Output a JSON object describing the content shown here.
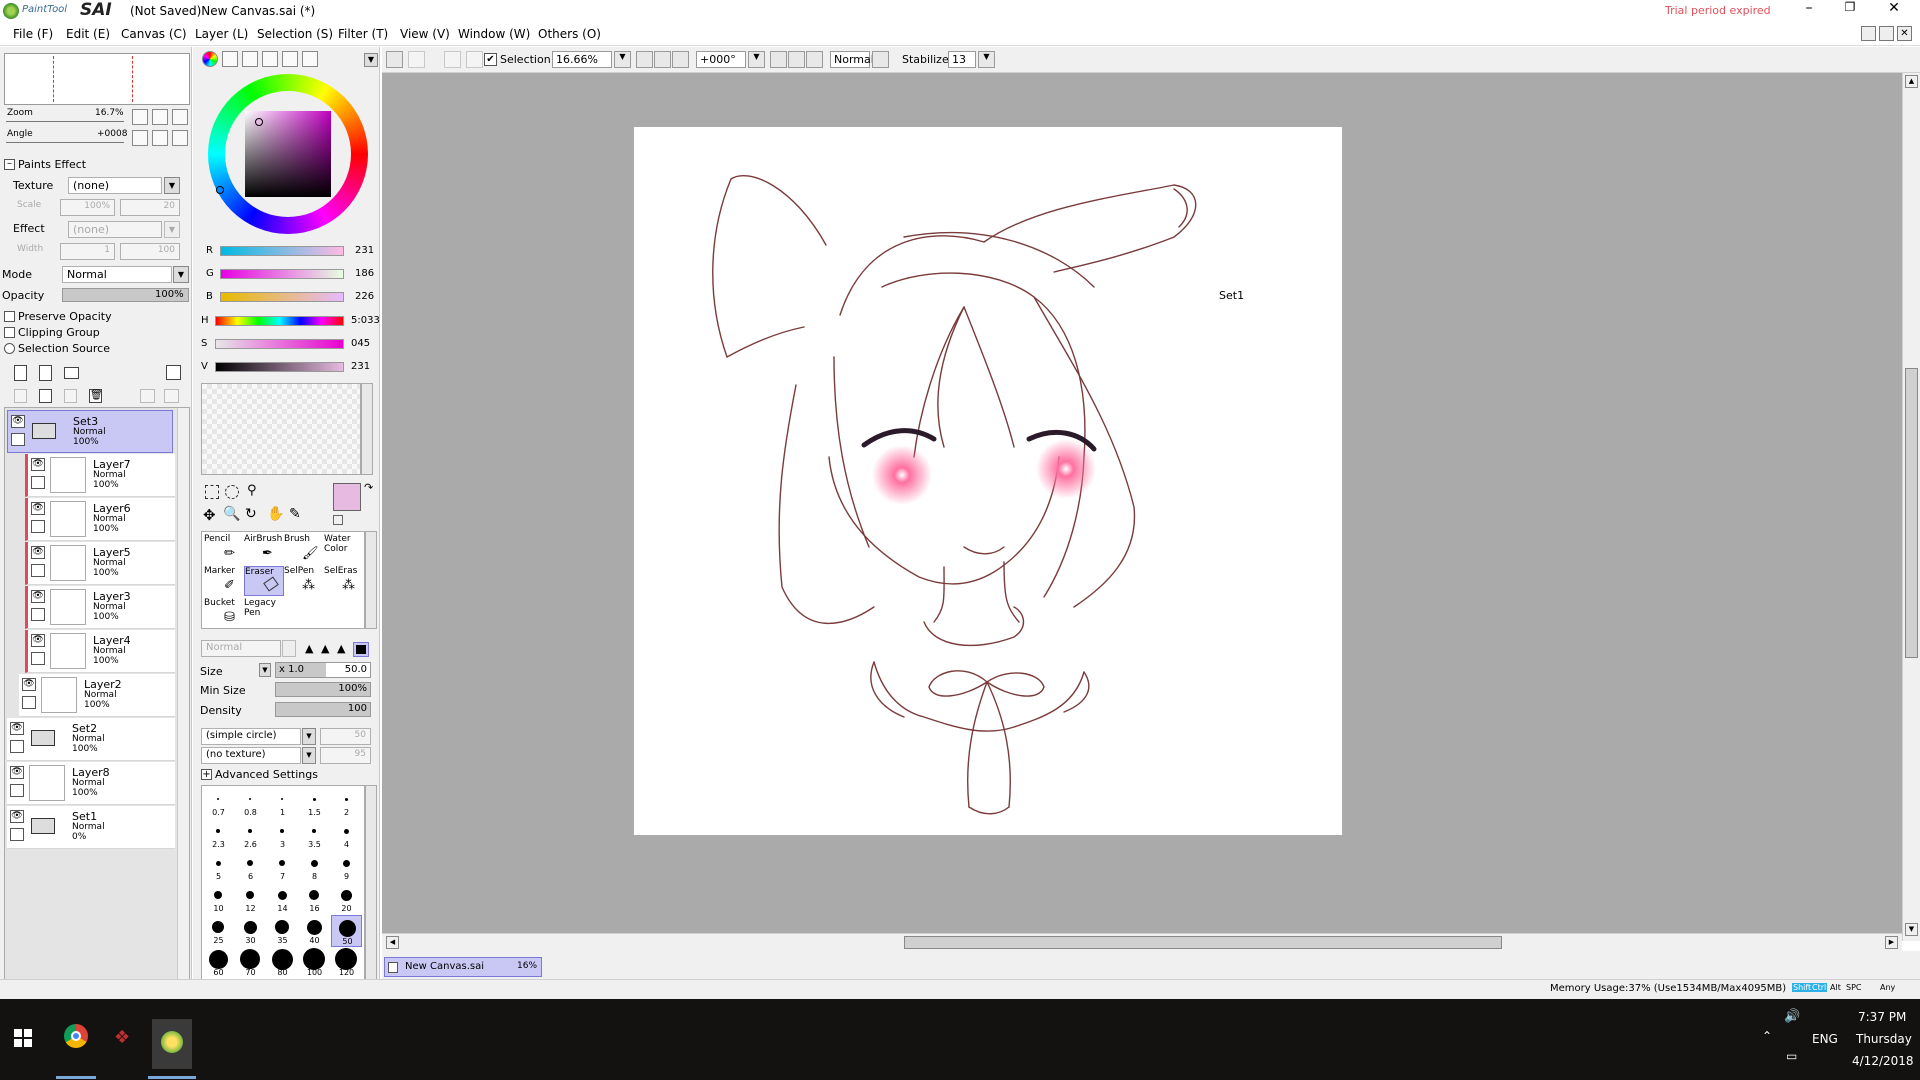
{
  "window": {
    "app_name": "SAI",
    "app_prefix": "PaintTool",
    "title": "(Not Saved)New Canvas.sai (*)",
    "trial": "Trial period expired",
    "accent_trial": "#e0505a"
  },
  "menu": [
    "File (F)",
    "Edit (E)",
    "Canvas (C)",
    "Layer (L)",
    "Selection (S)",
    "Filter (T)",
    "View (V)",
    "Window (W)",
    "Others (O)"
  ],
  "toolbar": {
    "selection_label": "Selection",
    "zoom_value": "16.66%",
    "angle_value": "+000°",
    "blend_mode": "Normal",
    "stabilizer_label": "Stabilizer",
    "stabilizer_value": "13"
  },
  "navigator": {
    "zoom_label": "Zoom",
    "zoom_value": "16.7%",
    "angle_label": "Angle",
    "angle_value": "+0008"
  },
  "paints_effect": {
    "header": "Paints Effect",
    "texture_label": "Texture",
    "texture_value": "(none)",
    "scale_label": "Scale",
    "scale_value": "100%",
    "scale_num": "20",
    "effect_label": "Effect",
    "effect_value": "(none)",
    "width_label": "Width",
    "width_value": "1",
    "width_num": "100"
  },
  "layer_props": {
    "mode_label": "Mode",
    "mode_value": "Normal",
    "opacity_label": "Opacity",
    "opacity_value": "100%",
    "preserve_opacity": "Preserve Opacity",
    "clipping_group": "Clipping Group",
    "selection_source": "Selection Source"
  },
  "layers": [
    {
      "name": "Set3",
      "mode": "Normal",
      "opacity": "100%",
      "kind": "folder",
      "selected": true
    },
    {
      "name": "Layer7",
      "mode": "Normal",
      "opacity": "100%",
      "kind": "layer"
    },
    {
      "name": "Layer6",
      "mode": "Normal",
      "opacity": "100%",
      "kind": "layer"
    },
    {
      "name": "Layer5",
      "mode": "Normal",
      "opacity": "100%",
      "kind": "layer"
    },
    {
      "name": "Layer3",
      "mode": "Normal",
      "opacity": "100%",
      "kind": "layer"
    },
    {
      "name": "Layer4",
      "mode": "Normal",
      "opacity": "100%",
      "kind": "layer"
    },
    {
      "name": "Layer2",
      "mode": "Normal",
      "opacity": "100%",
      "kind": "layer"
    },
    {
      "name": "Set2",
      "mode": "Normal",
      "opacity": "100%",
      "kind": "folder"
    },
    {
      "name": "Layer8",
      "mode": "Normal",
      "opacity": "100%",
      "kind": "layer"
    },
    {
      "name": "Set1",
      "mode": "Normal",
      "opacity": "0%",
      "kind": "folder"
    }
  ],
  "color": {
    "r_label": "R",
    "r_value": "231",
    "g_label": "G",
    "g_value": "186",
    "b_label": "B",
    "b_value": "226",
    "h_label": "H",
    "h_value": "5:033",
    "s_label": "S",
    "s_value": "045",
    "v_label": "V",
    "v_value": "231",
    "current": "#e7bae2"
  },
  "tools": {
    "brushes": [
      "Pencil",
      "AirBrush",
      "Brush",
      "Water Color",
      "Marker",
      "Eraser",
      "SelPen",
      "SelEras",
      "Bucket",
      "Legacy Pen"
    ],
    "selected_tool": "Eraser",
    "mode_value": "Normal",
    "size_label": "Size",
    "size_mult": "x 1.0",
    "size_value": "50.0",
    "min_size_label": "Min Size",
    "min_size_value": "100%",
    "density_label": "Density",
    "density_value": "100",
    "shape_value": "(simple circle)",
    "shape_num": "50",
    "texture_value": "(no texture)",
    "texture_num": "95",
    "advanced": "Advanced Settings",
    "brush_sizes": [
      "0.7",
      "0.8",
      "1",
      "1.5",
      "2",
      "2.3",
      "2.6",
      "3",
      "3.5",
      "4",
      "5",
      "6",
      "7",
      "8",
      "9",
      "10",
      "12",
      "14",
      "16",
      "20",
      "25",
      "30",
      "35",
      "40",
      "50",
      "60",
      "70",
      "80",
      "100",
      "120"
    ]
  },
  "canvas": {
    "set_label": "Set1",
    "tab_name": "New Canvas.sai",
    "tab_zoom": "16%"
  },
  "status": {
    "memory": "Memory Usage:37% (Use1534MB/Max4095MB)",
    "keys": [
      "Shift",
      "Ctrl",
      "Alt",
      "SPC",
      "Any"
    ]
  },
  "taskbar": {
    "lang": "ENG",
    "time": "7:37 PM",
    "day": "Thursday",
    "date": "4/12/2018"
  }
}
